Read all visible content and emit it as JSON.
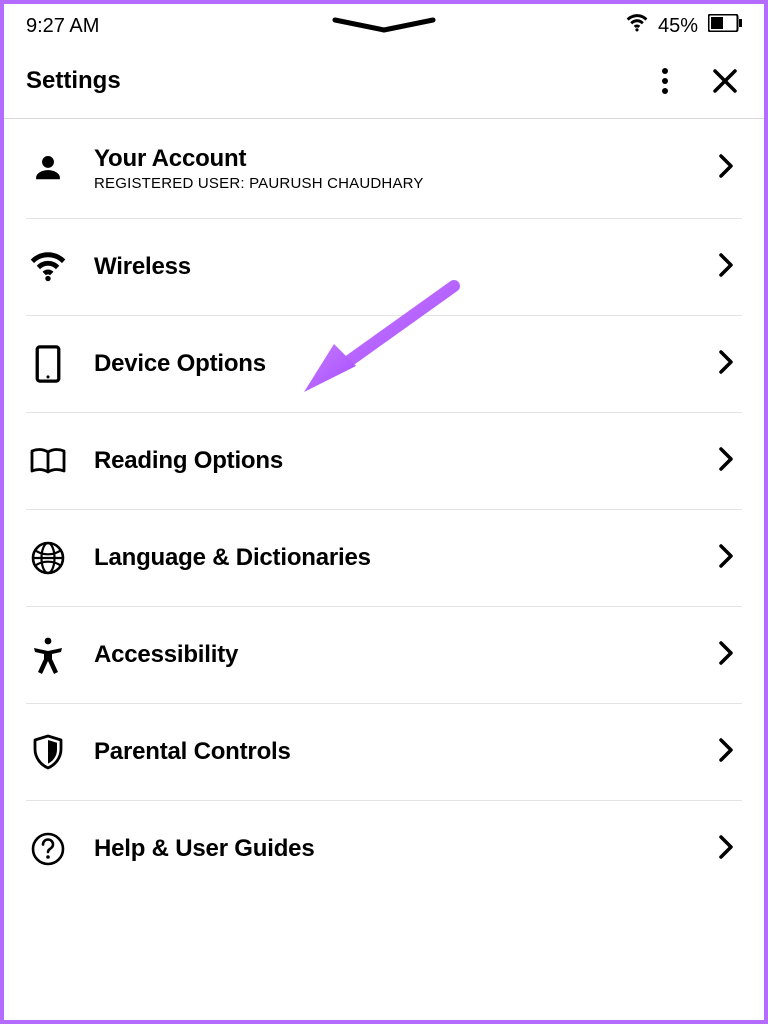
{
  "statusbar": {
    "time": "9:27 AM",
    "battery_percent": "45%"
  },
  "header": {
    "title": "Settings"
  },
  "rows": {
    "account": {
      "title": "Your Account",
      "subtitle": "REGISTERED USER: PAURUSH CHAUDHARY"
    },
    "wireless": {
      "title": "Wireless"
    },
    "device_options": {
      "title": "Device Options"
    },
    "reading_options": {
      "title": "Reading Options"
    },
    "language": {
      "title": "Language & Dictionaries"
    },
    "accessibility": {
      "title": "Accessibility"
    },
    "parental": {
      "title": "Parental Controls"
    },
    "help": {
      "title": "Help & User Guides"
    }
  },
  "annotation": {
    "color": "#b46bff",
    "points_to": "device_options"
  }
}
